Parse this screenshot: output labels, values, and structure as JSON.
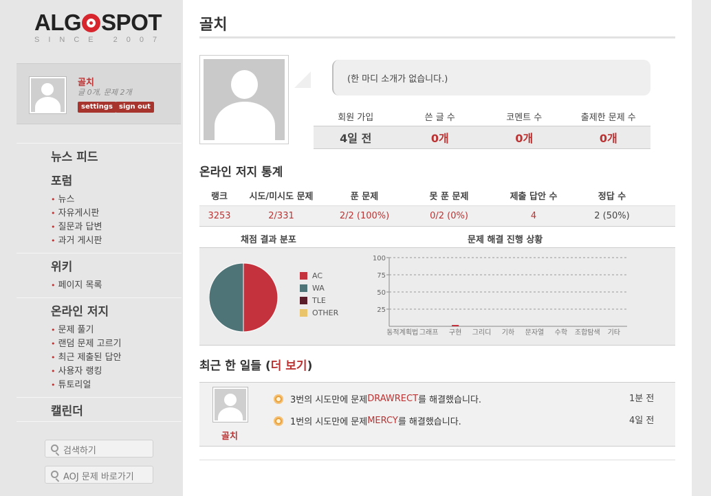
{
  "logo": {
    "left": "ALG",
    "right": "SPOT",
    "since": "SINCE 2007"
  },
  "user_box": {
    "name": "골치",
    "stats": "글 0개, 문제 2개",
    "settings_label": "settings",
    "signout_label": "sign out"
  },
  "nav": {
    "news_feed": "뉴스 피드",
    "forum": "포럼",
    "forum_items": [
      "뉴스",
      "자유게시판",
      "질문과 답변",
      "과거 게시판"
    ],
    "wiki": "위키",
    "wiki_items": [
      "페이지 목록"
    ],
    "judge": "온라인 저지",
    "judge_items": [
      "문제 풀기",
      "랜덤 문제 고르기",
      "최근 제출된 답안",
      "사용자 랭킹",
      "튜토리얼"
    ],
    "calendar": "캘린더"
  },
  "search": {
    "search_label": "검색하기",
    "aoj_label": "AOJ 문제 바로가기"
  },
  "profile": {
    "title": "골치",
    "intro": "(한 마디 소개가 없습니다.)",
    "stat_headers": [
      "회원 가입",
      "쓴 글 수",
      "코멘트 수",
      "출제한 문제 수"
    ],
    "stat_values": [
      "4일 전",
      "0개",
      "0개",
      "0개"
    ]
  },
  "judge_stats": {
    "title": "온라인 저지 통계",
    "headers": [
      "랭크",
      "시도/미시도 문제",
      "푼 문제",
      "못 푼 문제",
      "제출 답안 수",
      "정답 수"
    ],
    "values": [
      "3253",
      "2/331",
      "2/2 (100%)",
      "0/2 (0%)",
      "4",
      "2 (50%)"
    ]
  },
  "chart_titles": {
    "pie": "채점 결과 분포",
    "bar": "문제 해결 진행 상황"
  },
  "chart_data": [
    {
      "type": "pie",
      "title": "채점 결과 분포",
      "categories": [
        "AC",
        "WA",
        "TLE",
        "OTHER"
      ],
      "values": [
        2,
        2,
        0,
        0
      ],
      "colors": [
        "#c4323d",
        "#4e7478",
        "#5a1d2a",
        "#e9c46a"
      ],
      "legend": "right"
    },
    {
      "type": "bar",
      "title": "문제 해결 진행 상황",
      "categories": [
        "동적계획법",
        "그래프",
        "구현",
        "그리디",
        "기하",
        "문자열",
        "수학",
        "조합탐색",
        "기타"
      ],
      "values": [
        0,
        0,
        2,
        0,
        0,
        0,
        0,
        0,
        0
      ],
      "ylim": [
        0,
        100
      ],
      "yticks": [
        25,
        50,
        75,
        100
      ],
      "grid": true,
      "color": "#c4323d"
    }
  ],
  "recent": {
    "title_prefix": "최근 한 일들 (",
    "more": "더 보기",
    "title_suffix": ")",
    "user": "골치",
    "items": [
      {
        "pre": "3번의 시도만에 문제 ",
        "problem": "DRAWRECT",
        "post": "를 해결했습니다.",
        "time": "1분 전"
      },
      {
        "pre": "1번의 시도만에 문제 ",
        "problem": "MERCY",
        "post": "를 해결했습니다.",
        "time": "4일 전"
      }
    ]
  }
}
